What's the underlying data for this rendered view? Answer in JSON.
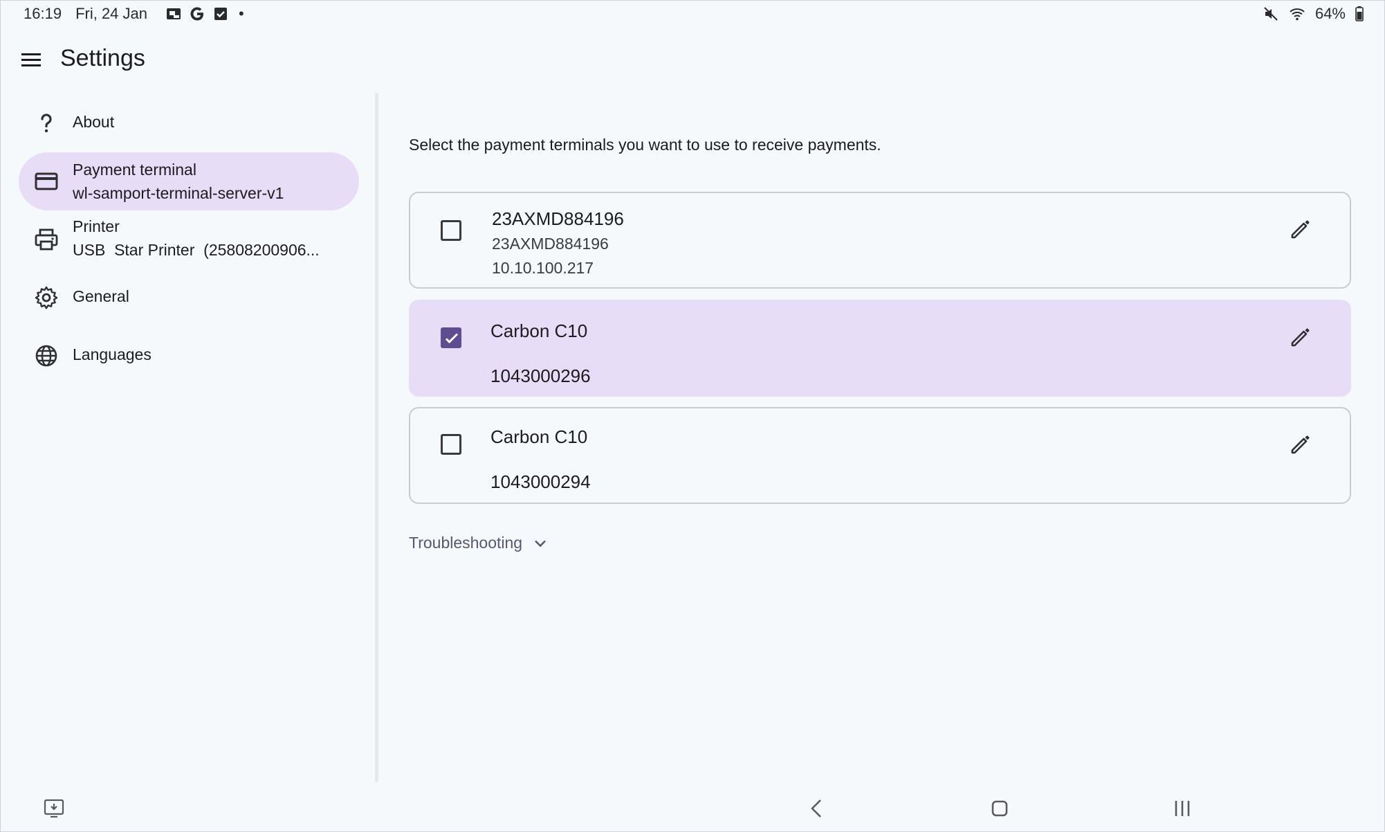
{
  "status_bar": {
    "time": "16:19",
    "date": "Fri, 24 Jan",
    "notification_icons": [
      "screenshot-icon",
      "google-icon",
      "checkbox-icon"
    ],
    "more_dot": "•",
    "battery": "64%"
  },
  "app_bar": {
    "title": "Settings"
  },
  "sidebar": {
    "items": [
      {
        "label": "About",
        "icon": "help-icon"
      },
      {
        "label": "Payment terminal",
        "sub": "wl-samport-terminal-server-v1",
        "icon": "credit-card-icon",
        "selected": true
      },
      {
        "label": "Printer",
        "sub": "USB  Star Printer  (25808200906...",
        "icon": "printer-icon"
      },
      {
        "label": "General",
        "icon": "gear-icon"
      },
      {
        "label": "Languages",
        "icon": "globe-icon"
      }
    ]
  },
  "main": {
    "intro": "Select the payment terminals you want to use to receive payments.",
    "terminals": [
      {
        "name": "23AXMD884196",
        "serial": "23AXMD884196",
        "ip": "10.10.100.217",
        "checked": false
      },
      {
        "name": "Carbon C10",
        "serial": "1043000296",
        "checked": true
      },
      {
        "name": "Carbon C10",
        "serial": "1043000294",
        "checked": false
      }
    ],
    "troubleshooting": "Troubleshooting"
  },
  "colors": {
    "background": "#f6f9fc",
    "selected": "#e8ddf6",
    "accent": "#5e4e8f",
    "border": "#c8cbd0"
  }
}
